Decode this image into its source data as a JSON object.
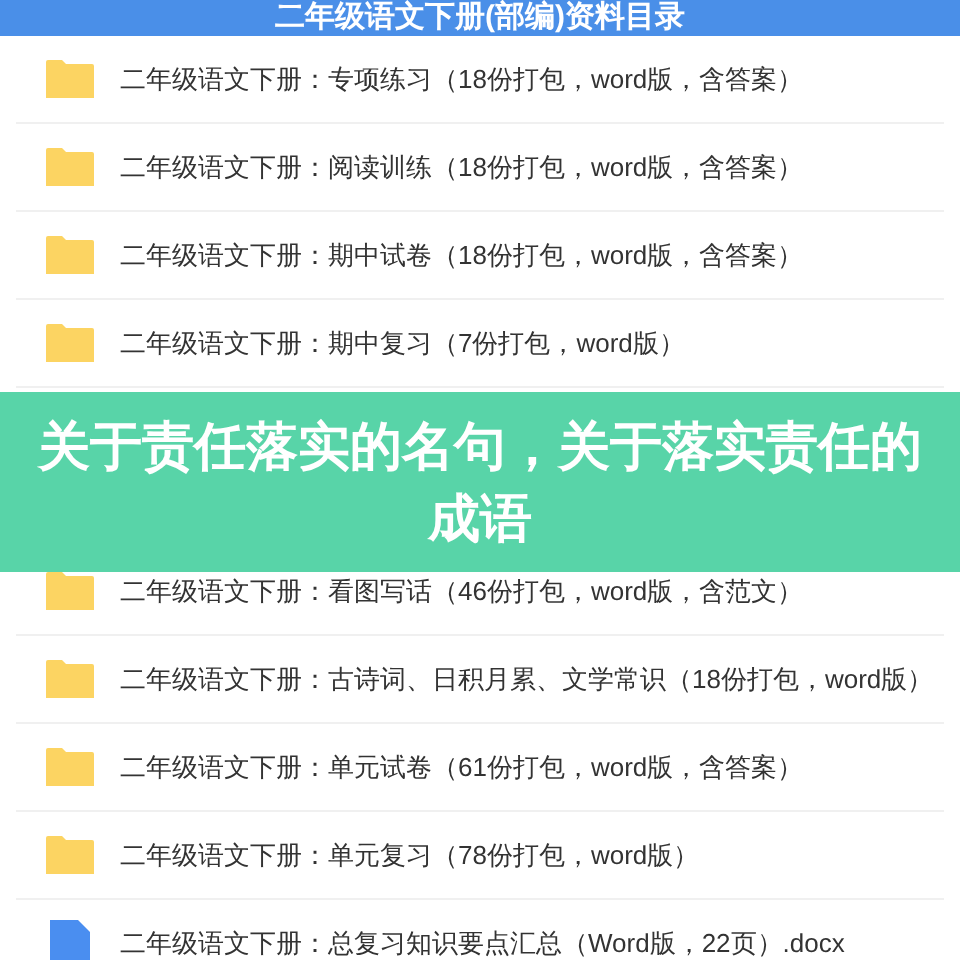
{
  "header": {
    "title": "二年级语文下册(部编)资料目录"
  },
  "rows_top": [
    {
      "kind": "folder",
      "name": "二年级语文下册：专项练习（18份打包，word版，含答案）"
    },
    {
      "kind": "folder",
      "name": "二年级语文下册：阅读训练（18份打包，word版，含答案）"
    },
    {
      "kind": "folder",
      "name": "二年级语文下册：期中试卷（18份打包，word版，含答案）"
    },
    {
      "kind": "folder",
      "name": "二年级语文下册：期中复习（7份打包，word版）"
    }
  ],
  "banner": {
    "title": "关于责任落实的名句，关于落实责任的成语"
  },
  "rows_bottom": [
    {
      "kind": "folder",
      "name": "二年级语文下册：看图写话（46份打包，word版，含范文）"
    },
    {
      "kind": "folder",
      "name": "二年级语文下册：古诗词、日积月累、文学常识（18份打包，word版）"
    },
    {
      "kind": "folder",
      "name": "二年级语文下册：单元试卷（61份打包，word版，含答案）"
    },
    {
      "kind": "folder",
      "name": "二年级语文下册：单元复习（78份打包，word版）"
    },
    {
      "kind": "word",
      "name": "二年级语文下册：总复习知识要点汇总（Word版，22页）.docx"
    }
  ]
}
